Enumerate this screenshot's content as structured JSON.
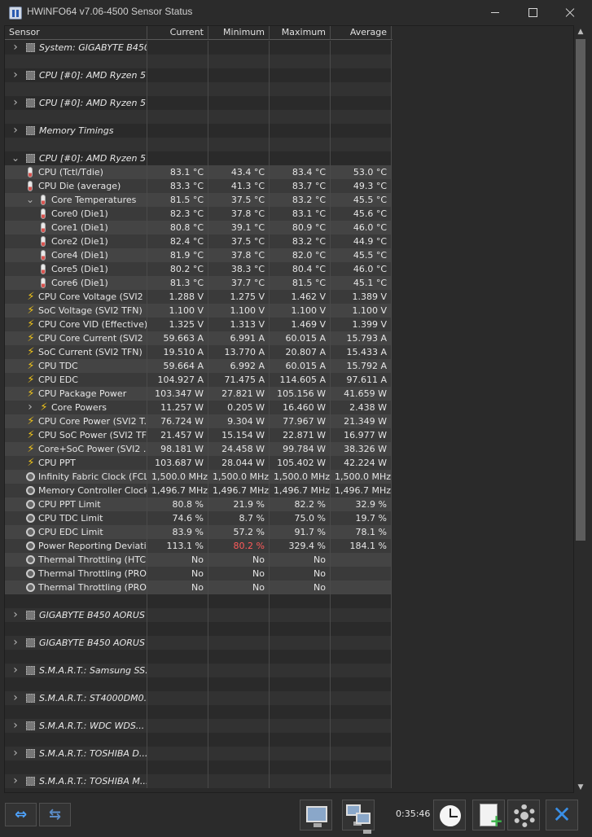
{
  "window": {
    "title": "HWiNFO64 v7.06-4500 Sensor Status"
  },
  "columns": [
    "Sensor",
    "Current",
    "Minimum",
    "Maximum",
    "Average"
  ],
  "rows": [
    {
      "type": "group",
      "label": "System: GIGABYTE B450...",
      "level": 0
    },
    {
      "type": "blank"
    },
    {
      "type": "group",
      "label": "CPU [#0]: AMD Ryzen 5 ...",
      "level": 0
    },
    {
      "type": "blank"
    },
    {
      "type": "group",
      "label": "CPU [#0]: AMD Ryzen 5 ...",
      "level": 0
    },
    {
      "type": "blank"
    },
    {
      "type": "group",
      "label": "Memory Timings",
      "level": 0
    },
    {
      "type": "blank"
    },
    {
      "type": "group",
      "label": "CPU [#0]: AMD Ryzen 5 ...",
      "level": 0,
      "expanded": true
    },
    {
      "type": "sensor",
      "icon": "thermometer-icon",
      "label": "CPU (Tctl/Tdie)",
      "cur": "83.1 °C",
      "min": "43.4 °C",
      "max": "83.4 °C",
      "avg": "53.0 °C",
      "level": 1
    },
    {
      "type": "sensor",
      "icon": "thermometer-icon",
      "label": "CPU Die (average)",
      "cur": "83.3 °C",
      "min": "41.3 °C",
      "max": "83.7 °C",
      "avg": "49.3 °C",
      "level": 1
    },
    {
      "type": "sensor",
      "icon": "thermometer-icon",
      "label": "Core Temperatures",
      "cur": "81.5 °C",
      "min": "37.5 °C",
      "max": "83.2 °C",
      "avg": "45.5 °C",
      "level": 2,
      "caret": "down"
    },
    {
      "type": "sensor",
      "icon": "thermometer-icon",
      "label": "Core0 (Die1)",
      "cur": "82.3 °C",
      "min": "37.8 °C",
      "max": "83.1 °C",
      "avg": "45.6 °C",
      "level": 2
    },
    {
      "type": "sensor",
      "icon": "thermometer-icon",
      "label": "Core1 (Die1)",
      "cur": "80.8 °C",
      "min": "39.1 °C",
      "max": "80.9 °C",
      "avg": "46.0 °C",
      "level": 2
    },
    {
      "type": "sensor",
      "icon": "thermometer-icon",
      "label": "Core2 (Die1)",
      "cur": "82.4 °C",
      "min": "37.5 °C",
      "max": "83.2 °C",
      "avg": "44.9 °C",
      "level": 2
    },
    {
      "type": "sensor",
      "icon": "thermometer-icon",
      "label": "Core4 (Die1)",
      "cur": "81.9 °C",
      "min": "37.8 °C",
      "max": "82.0 °C",
      "avg": "45.5 °C",
      "level": 2
    },
    {
      "type": "sensor",
      "icon": "thermometer-icon",
      "label": "Core5 (Die1)",
      "cur": "80.2 °C",
      "min": "38.3 °C",
      "max": "80.4 °C",
      "avg": "46.0 °C",
      "level": 2
    },
    {
      "type": "sensor",
      "icon": "thermometer-icon",
      "label": "Core6 (Die1)",
      "cur": "81.3 °C",
      "min": "37.7 °C",
      "max": "81.5 °C",
      "avg": "45.1 °C",
      "level": 2
    },
    {
      "type": "sensor",
      "icon": "bolt-icon",
      "label": "CPU Core Voltage (SVI2 ...",
      "cur": "1.288 V",
      "min": "1.275 V",
      "max": "1.462 V",
      "avg": "1.389 V",
      "level": 1
    },
    {
      "type": "sensor",
      "icon": "bolt-icon",
      "label": "SoC Voltage (SVI2 TFN)",
      "cur": "1.100 V",
      "min": "1.100 V",
      "max": "1.100 V",
      "avg": "1.100 V",
      "level": 1
    },
    {
      "type": "sensor",
      "icon": "bolt-icon",
      "label": "CPU Core VID (Effective)",
      "cur": "1.325 V",
      "min": "1.313 V",
      "max": "1.469 V",
      "avg": "1.399 V",
      "level": 1
    },
    {
      "type": "sensor",
      "icon": "bolt-icon",
      "label": "CPU Core Current (SVI2 ...",
      "cur": "59.663 A",
      "min": "6.991 A",
      "max": "60.015 A",
      "avg": "15.793 A",
      "level": 1
    },
    {
      "type": "sensor",
      "icon": "bolt-icon",
      "label": "SoC Current (SVI2 TFN)",
      "cur": "19.510 A",
      "min": "13.770 A",
      "max": "20.807 A",
      "avg": "15.433 A",
      "level": 1
    },
    {
      "type": "sensor",
      "icon": "bolt-icon",
      "label": "CPU TDC",
      "cur": "59.664 A",
      "min": "6.992 A",
      "max": "60.015 A",
      "avg": "15.792 A",
      "level": 1
    },
    {
      "type": "sensor",
      "icon": "bolt-icon",
      "label": "CPU EDC",
      "cur": "104.927 A",
      "min": "71.475 A",
      "max": "114.605 A",
      "avg": "97.611 A",
      "level": 1
    },
    {
      "type": "sensor",
      "icon": "bolt-icon",
      "label": "CPU Package Power",
      "cur": "103.347 W",
      "min": "27.821 W",
      "max": "105.156 W",
      "avg": "41.659 W",
      "level": 1
    },
    {
      "type": "sensor",
      "icon": "bolt-icon",
      "label": "Core Powers",
      "cur": "11.257 W",
      "min": "0.205 W",
      "max": "16.460 W",
      "avg": "2.438 W",
      "level": 2,
      "caret": "right"
    },
    {
      "type": "sensor",
      "icon": "bolt-icon",
      "label": "CPU Core Power (SVI2 T...",
      "cur": "76.724 W",
      "min": "9.304 W",
      "max": "77.967 W",
      "avg": "21.349 W",
      "level": 1
    },
    {
      "type": "sensor",
      "icon": "bolt-icon",
      "label": "CPU SoC Power (SVI2 TFN)",
      "cur": "21.457 W",
      "min": "15.154 W",
      "max": "22.871 W",
      "avg": "16.977 W",
      "level": 1
    },
    {
      "type": "sensor",
      "icon": "bolt-icon",
      "label": "Core+SoC Power (SVI2 ...",
      "cur": "98.181 W",
      "min": "24.458 W",
      "max": "99.784 W",
      "avg": "38.326 W",
      "level": 1
    },
    {
      "type": "sensor",
      "icon": "bolt-icon",
      "label": "CPU PPT",
      "cur": "103.687 W",
      "min": "28.044 W",
      "max": "105.402 W",
      "avg": "42.224 W",
      "level": 1
    },
    {
      "type": "sensor",
      "icon": "clock-icon",
      "label": "Infinity Fabric Clock (FCLK)",
      "cur": "1,500.0 MHz",
      "min": "1,500.0 MHz",
      "max": "1,500.0 MHz",
      "avg": "1,500.0 MHz",
      "level": 1
    },
    {
      "type": "sensor",
      "icon": "clock-icon",
      "label": "Memory Controller Clock ...",
      "cur": "1,496.7 MHz",
      "min": "1,496.7 MHz",
      "max": "1,496.7 MHz",
      "avg": "1,496.7 MHz",
      "level": 1
    },
    {
      "type": "sensor",
      "icon": "clock-icon",
      "label": "CPU PPT Limit",
      "cur": "80.8 %",
      "min": "21.9 %",
      "max": "82.2 %",
      "avg": "32.9 %",
      "level": 1
    },
    {
      "type": "sensor",
      "icon": "clock-icon",
      "label": "CPU TDC Limit",
      "cur": "74.6 %",
      "min": "8.7 %",
      "max": "75.0 %",
      "avg": "19.7 %",
      "level": 1
    },
    {
      "type": "sensor",
      "icon": "clock-icon",
      "label": "CPU EDC Limit",
      "cur": "83.9 %",
      "min": "57.2 %",
      "max": "91.7 %",
      "avg": "78.1 %",
      "level": 1
    },
    {
      "type": "sensor",
      "icon": "clock-icon",
      "label": "Power Reporting Deviati...",
      "cur": "113.1 %",
      "min": "80.2 %",
      "max": "329.4 %",
      "avg": "184.1 %",
      "level": 1,
      "min_red": true
    },
    {
      "type": "sensor",
      "icon": "clock-icon",
      "label": "Thermal Throttling (HTC)",
      "cur": "No",
      "min": "No",
      "max": "No",
      "avg": "",
      "level": 1
    },
    {
      "type": "sensor",
      "icon": "clock-icon",
      "label": "Thermal Throttling (PRO...",
      "cur": "No",
      "min": "No",
      "max": "No",
      "avg": "",
      "level": 1
    },
    {
      "type": "sensor",
      "icon": "clock-icon",
      "label": "Thermal Throttling (PRO...",
      "cur": "No",
      "min": "No",
      "max": "No",
      "avg": "",
      "level": 1
    },
    {
      "type": "blank"
    },
    {
      "type": "group",
      "label": "GIGABYTE B450 AORUS ...",
      "level": 0
    },
    {
      "type": "blank"
    },
    {
      "type": "group",
      "label": "GIGABYTE B450 AORUS ...",
      "level": 0
    },
    {
      "type": "blank"
    },
    {
      "type": "group",
      "label": "S.M.A.R.T.: Samsung SS...",
      "level": 0
    },
    {
      "type": "blank"
    },
    {
      "type": "group",
      "label": "S.M.A.R.T.: ST4000DM0...",
      "level": 0
    },
    {
      "type": "blank"
    },
    {
      "type": "group",
      "label": "S.M.A.R.T.: WDC  WDS...",
      "level": 0
    },
    {
      "type": "blank"
    },
    {
      "type": "group",
      "label": "S.M.A.R.T.: TOSHIBA D...",
      "level": 0
    },
    {
      "type": "blank"
    },
    {
      "type": "group",
      "label": "S.M.A.R.T.: TOSHIBA M...",
      "level": 0
    }
  ],
  "toolbar": {
    "timer": "0:35:46"
  },
  "colors": {
    "warning_red": "#ff5b5b",
    "bolt_yellow": "#f0c419",
    "accent_blue": "#3a8fe6"
  }
}
